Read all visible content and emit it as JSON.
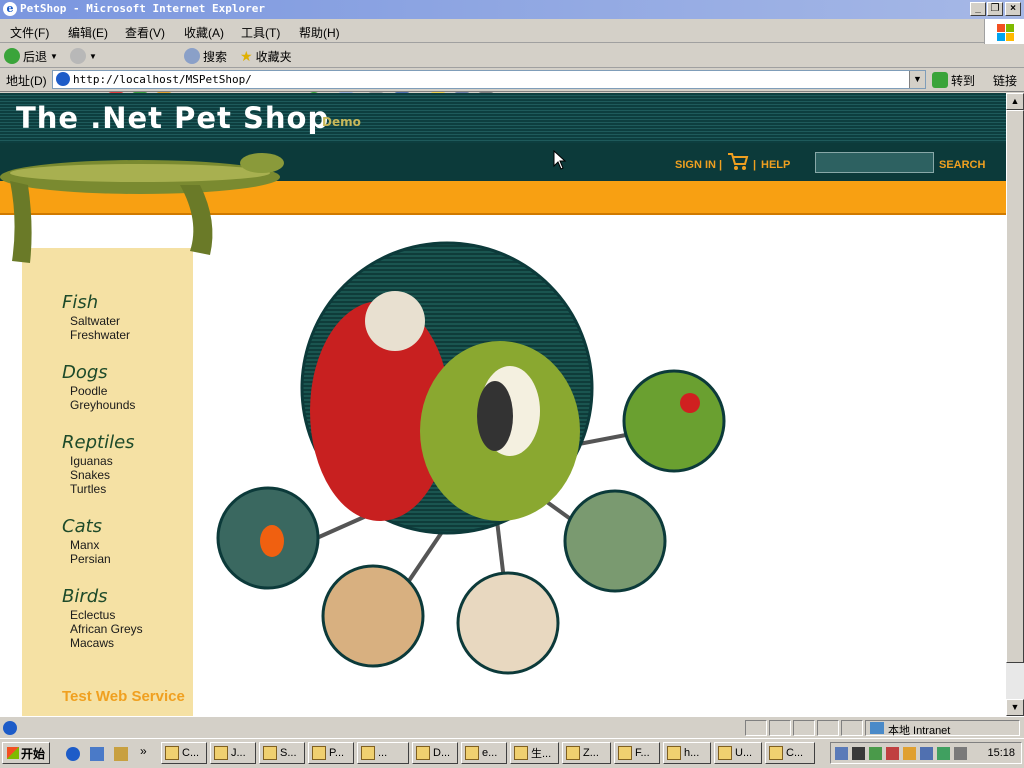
{
  "window": {
    "title": "PetShop - Microsoft Internet Explorer"
  },
  "menu": [
    "文件(F)",
    "编辑(E)",
    "查看(V)",
    "收藏(A)",
    "工具(T)",
    "帮助(H)"
  ],
  "toolbar": {
    "back_label": "后退",
    "search_label": "搜索",
    "favorites_label": "收藏夹"
  },
  "address": {
    "label": "地址(D)",
    "url": "http://localhost/MSPetShop/",
    "go_label": "转到",
    "links_label": "链接"
  },
  "site": {
    "logo_text": "The .Net Pet Shop",
    "demo_text": "Demo",
    "nav": {
      "sign_in": "SIGN IN",
      "sep1": "|",
      "sep2": "|",
      "help": "HELP",
      "search": "SEARCH"
    },
    "search_value": ""
  },
  "sidebar": {
    "categories": [
      {
        "name": "Fish",
        "items": [
          "Saltwater",
          "Freshwater"
        ]
      },
      {
        "name": "Dogs",
        "items": [
          "Poodle",
          "Greyhounds"
        ]
      },
      {
        "name": "Reptiles",
        "items": [
          "Iguanas",
          "Snakes",
          "Turtles"
        ]
      },
      {
        "name": "Cats",
        "items": [
          "Manx",
          "Persian"
        ]
      },
      {
        "name": "Birds",
        "items": [
          "Eclectus",
          "African Greys",
          "Macaws"
        ]
      }
    ],
    "test_web_service": "Test Web Service"
  },
  "status": {
    "zone": "本地 Intranet"
  },
  "taskbar": {
    "start": "开始",
    "chevron": "»",
    "tasks": [
      "C...",
      "J...",
      "S...",
      "P...",
      "...",
      "D...",
      "e...",
      "生...",
      "Z...",
      "F...",
      "h...",
      "U...",
      "C..."
    ],
    "clock": "15:18"
  },
  "colors": {
    "header_dark": "#0c3a3a",
    "accent_orange": "#f8a012",
    "sidebar_bg": "#f5e1a4",
    "link_orange": "#f0a020"
  }
}
